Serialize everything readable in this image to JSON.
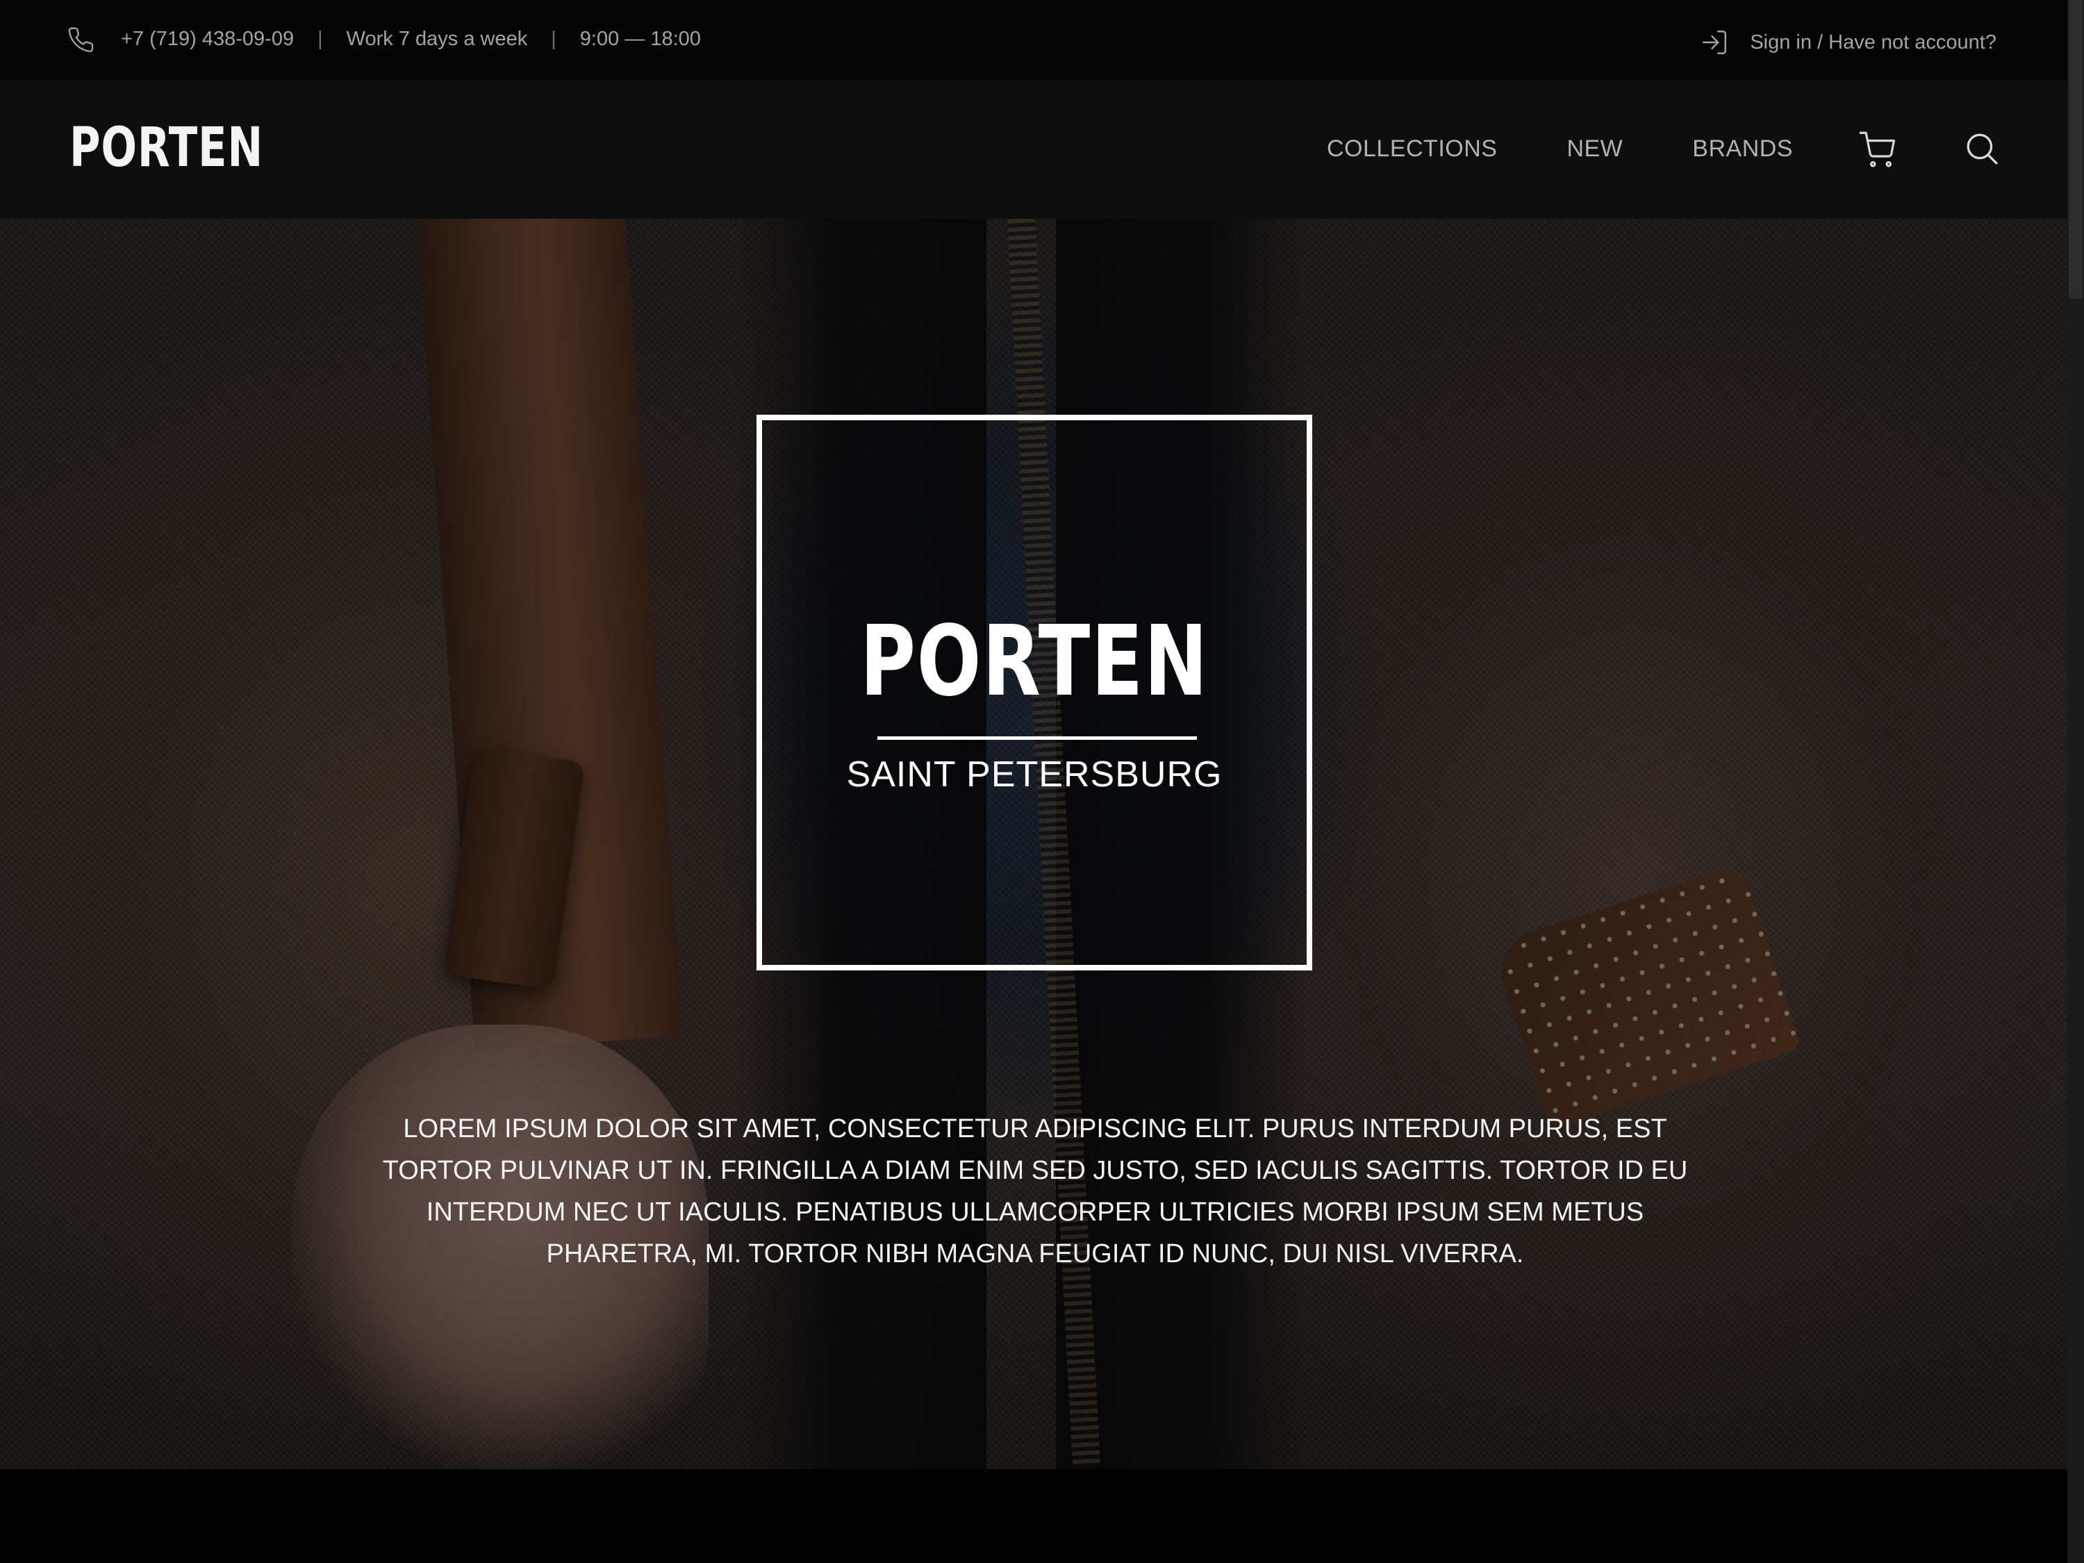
{
  "topbar": {
    "phone": "+7 (719) 438-09-09",
    "separator": "|",
    "work_days": "Work 7 days a week",
    "hours": "9:00 — 18:00",
    "signin": "Sign in / Have not account?"
  },
  "header": {
    "logo": "PORTEN",
    "nav": [
      {
        "label": "COLLECTIONS"
      },
      {
        "label": "NEW"
      },
      {
        "label": "BRANDS"
      }
    ]
  },
  "hero": {
    "logo": "PORTEN",
    "city": "SAINT PETERSBURG",
    "description": "LOREM IPSUM DOLOR SIT AMET, CONSECTETUR ADIPISCING ELIT. PURUS INTERDUM PURUS, EST TORTOR PULVINAR UT IN. FRINGILLA A DIAM ENIM SED JUSTO, SED IACULIS SAGITTIS. TORTOR ID EU INTERDUM NEC UT IACULIS. PENATIBUS ULLAMCORPER ULTRICIES MORBI IPSUM SEM METUS PHARETRA, MI. TORTOR NIBH MAGNA FEUGIAT ID NUNC, DUI NISL VIVERRA."
  },
  "icons": {
    "phone": "phone-icon",
    "signin": "sign-in-icon",
    "cart": "cart-icon",
    "search": "search-icon"
  },
  "colors": {
    "topbar_bg": "#050505",
    "header_bg": "#0e0e0e",
    "nav_text": "#b2b2b2",
    "accent": "#ffffff"
  }
}
